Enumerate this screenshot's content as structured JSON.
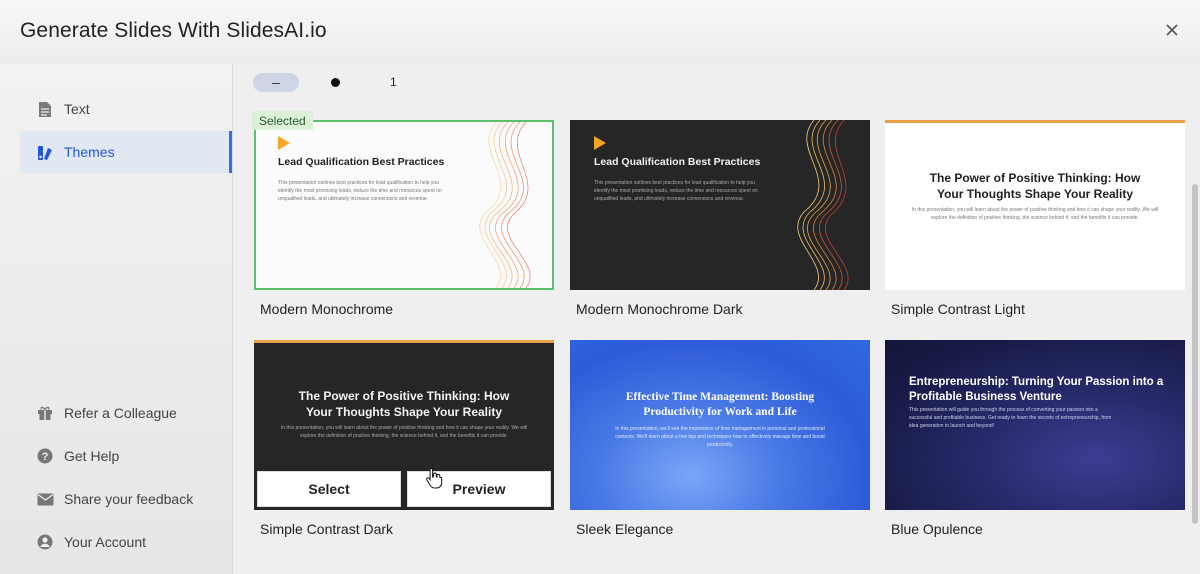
{
  "header": {
    "title": "Generate Slides With SlidesAI.io"
  },
  "sidebar": {
    "nav": [
      {
        "label": "Text",
        "icon": "document-icon"
      },
      {
        "label": "Themes",
        "icon": "palette-icon",
        "active": true
      }
    ],
    "bottom": [
      {
        "label": "Refer a Colleague",
        "icon": "gift-icon"
      },
      {
        "label": "Get Help",
        "icon": "help-icon"
      },
      {
        "label": "Share your feedback",
        "icon": "mail-icon"
      },
      {
        "label": "Your Account",
        "icon": "account-icon"
      }
    ]
  },
  "pager": {
    "pill": "–",
    "page": "1"
  },
  "selected_badge": "Selected",
  "themes": [
    {
      "name": "Modern Monochrome",
      "slide_title": "Lead Qualification Best Practices",
      "slide_body": "This presentation outlines best practices for lead qualification to help you identify the most promising leads, reduce the time and resources spent on unqualified leads, and ultimately increase conversions and revenue."
    },
    {
      "name": "Modern Monochrome Dark",
      "slide_title": "Lead Qualification Best Practices",
      "slide_body": "This presentation outlines best practices for lead qualification to help you identify the most promising leads, reduce the time and resources spent on unqualified leads, and ultimately increase conversions and revenue."
    },
    {
      "name": "Simple Contrast Light",
      "slide_title": "The Power of Positive Thinking: How Your Thoughts Shape Your Reality",
      "slide_body": "In this presentation, you will learn about the power of positive thinking and how it can shape your reality. We will explore the definition of positive thinking, the science behind it, and the benefits it can provide."
    },
    {
      "name": "Simple Contrast Dark",
      "slide_title": "The Power of Positive Thinking: How Your Thoughts Shape Your Reality",
      "slide_body": "In this presentation, you will learn about the power of positive thinking and how it can shape your reality. We will explore the definition of positive thinking, the science behind it, and the benefits it can provide."
    },
    {
      "name": "Sleek Elegance",
      "slide_title": "Effective Time Management: Boosting Productivity for Work and Life",
      "slide_body": "In this presentation, we'll see the importance of time management in personal and professional contexts. We'll learn about a few tips and techniques how to effectively manage time and boost productivity."
    },
    {
      "name": "Blue Opulence",
      "slide_title": "Entrepreneurship: Turning Your Passion into a Profitable Business Venture",
      "slide_body": "This presentation will guide you through the process of converting your passion into a successful and profitable business. Get ready to learn the secrets of entrepreneurship, from idea generation to launch and beyond!"
    }
  ],
  "hover_buttons": {
    "select": "Select",
    "preview": "Preview"
  },
  "colors": {
    "accent": "#3a6ee0",
    "selected_border": "#5cc06a",
    "orange_bar": "#e8a04a"
  }
}
